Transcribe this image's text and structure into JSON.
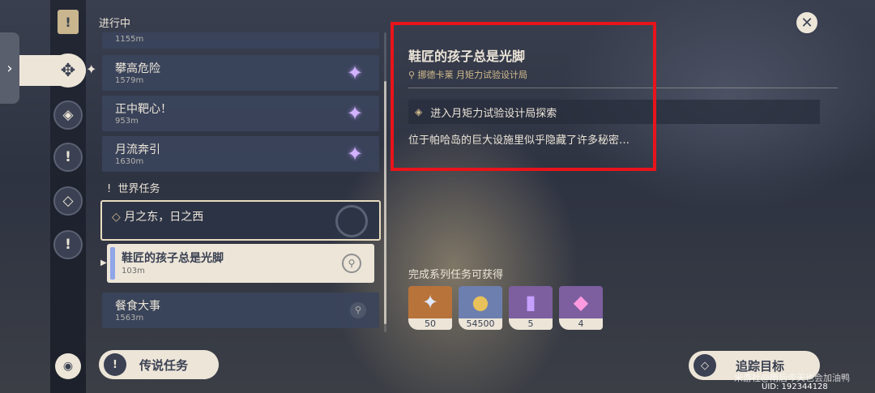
{
  "header": {
    "in_progress": "进行中"
  },
  "list": {
    "top_partial_dist": "1155m",
    "items": [
      {
        "title": "攀高危险",
        "dist": "1579m"
      },
      {
        "title": "正中靶心！",
        "dist": "953m"
      },
      {
        "title": "月流奔引",
        "dist": "1630m"
      }
    ],
    "world_section": "世界任务",
    "chain_title": "月之东，日之西",
    "selected": {
      "title": "鞋匠的孩子总是光脚",
      "dist": "103m"
    },
    "next": {
      "title": "餐食大事",
      "dist": "1563m"
    }
  },
  "detail": {
    "title": "鞋匠的孩子总是光脚",
    "location": "挪德卡莱 月矩力试验设计局",
    "objective": "进入月矩力试验设计局探索",
    "description": "位于帕哈岛的巨大设施里似乎隐藏了许多秘密…",
    "rewards_label": "完成系列任务可获得",
    "rewards": [
      {
        "name": "primogem-icon",
        "count": "50",
        "bg": "#b8733a"
      },
      {
        "name": "mora-icon",
        "count": "54500",
        "bg": "#6d7fae"
      },
      {
        "name": "book-icon",
        "count": "5",
        "bg": "#7d5fa0"
      },
      {
        "name": "crystal-icon",
        "count": "4",
        "bg": "#7d5fa0"
      }
    ]
  },
  "buttons": {
    "legend": "传说任务",
    "track": "追踪目标"
  },
  "footer": {
    "watermark": "米游社@雨后今天也会加油鸭",
    "uid": "UID: 192344128"
  },
  "colors": {
    "accent": "#ece5d8",
    "highlight": "#e8141b",
    "panel": "#3a445c"
  }
}
